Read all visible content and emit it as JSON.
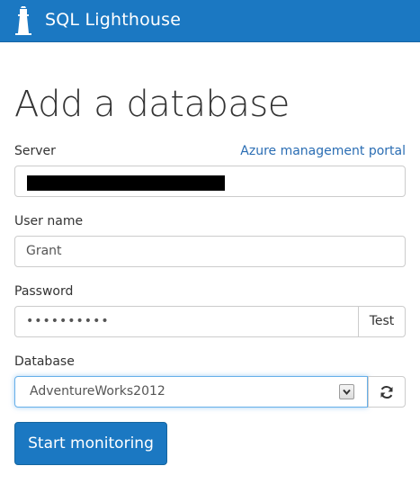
{
  "header": {
    "app_title": "SQL Lighthouse",
    "logo_icon": "lighthouse-icon",
    "background": "#1b78c2"
  },
  "page": {
    "title": "Add a database"
  },
  "form": {
    "server": {
      "label": "Server",
      "value": "",
      "value_redacted": true,
      "link_text": "Azure management portal"
    },
    "user_name": {
      "label": "User name",
      "value": "Grant"
    },
    "password": {
      "label": "Password",
      "masked_value": "••••••••••",
      "test_label": "Test"
    },
    "database": {
      "label": "Database",
      "selected": "AdventureWorks2012",
      "refresh_icon": "refresh-icon",
      "arrow_icon": "chevron-down-icon"
    },
    "submit_label": "Start monitoring"
  },
  "colors": {
    "accent": "#1b78c2",
    "link": "#2a6db3",
    "focus": "#66afe9"
  }
}
